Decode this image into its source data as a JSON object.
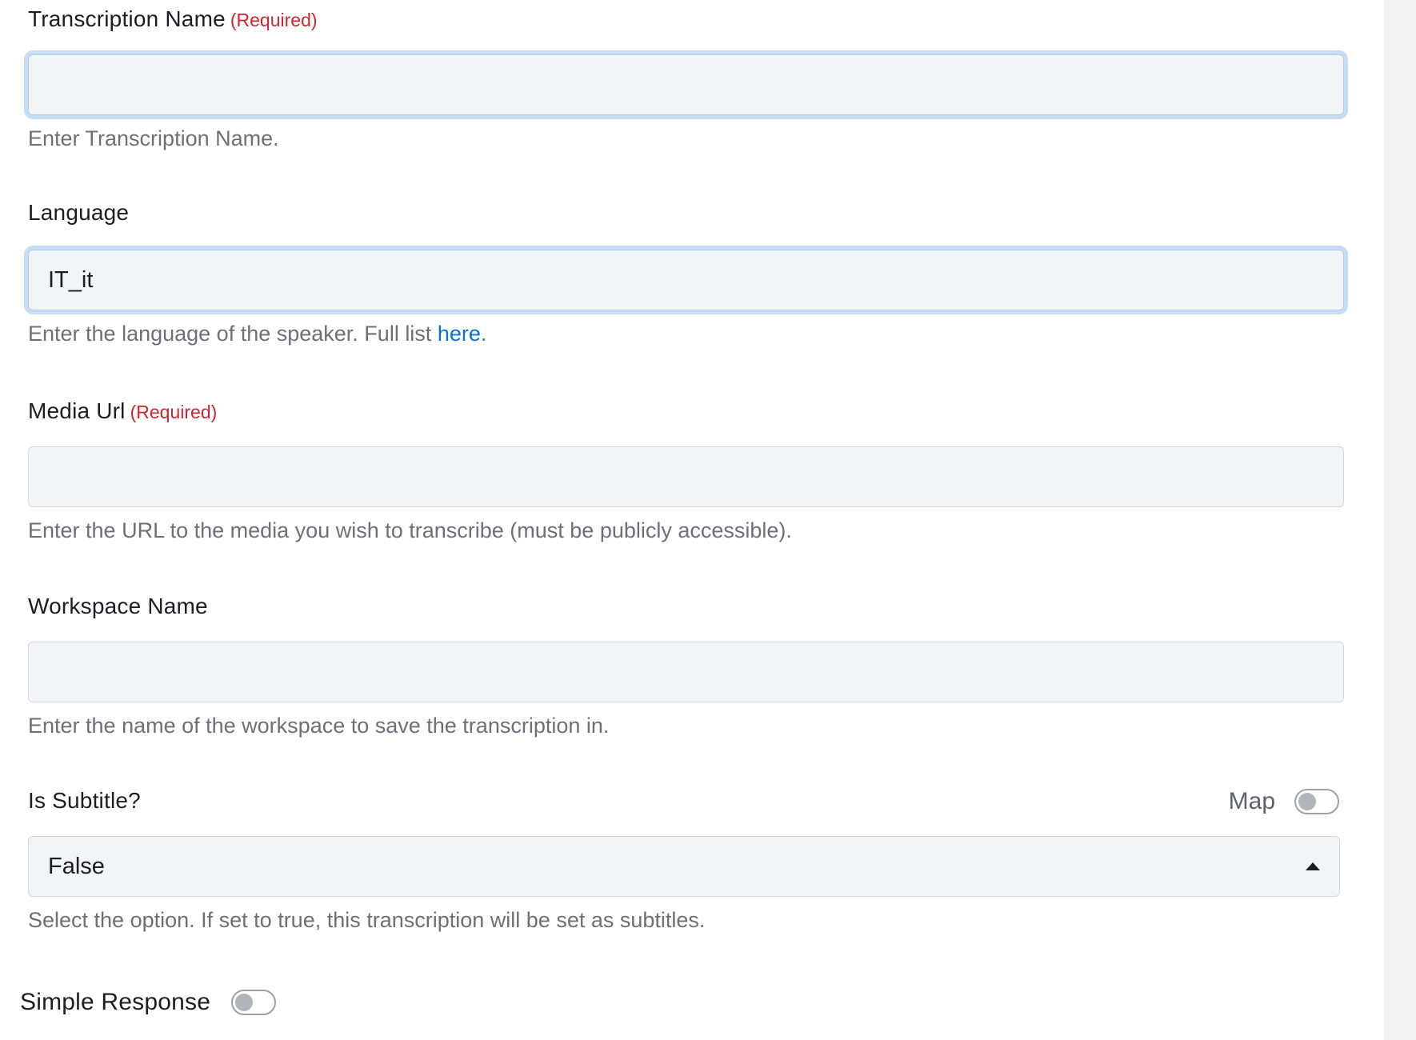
{
  "fields": {
    "transcription_name": {
      "label": "Transcription Name",
      "required": "(Required)",
      "value": "",
      "help": "Enter Transcription Name."
    },
    "language": {
      "label": "Language",
      "value": "IT_it",
      "help_prefix": "Enter the language of the speaker. Full list ",
      "help_link": "here",
      "help_suffix": "."
    },
    "media_url": {
      "label": "Media Url",
      "required": "(Required)",
      "value": "",
      "help": "Enter the URL to the media you wish to transcribe (must be publicly accessible)."
    },
    "workspace_name": {
      "label": "Workspace Name",
      "value": "",
      "help": "Enter the name of the workspace to save the transcription in."
    },
    "is_subtitle": {
      "label": "Is Subtitle?",
      "map_label": "Map",
      "map_enabled": false,
      "selected": "False",
      "help": "Select the option.  If set to true, this transcription will be set as subtitles."
    }
  },
  "simple_response": {
    "label": "Simple Response",
    "enabled": false
  },
  "colors": {
    "required": "#d1242f",
    "link": "#0a72d6",
    "input_bg": "#f2f5f8",
    "focus_ring": "#c6ddf5",
    "help_text": "#6b7079"
  }
}
